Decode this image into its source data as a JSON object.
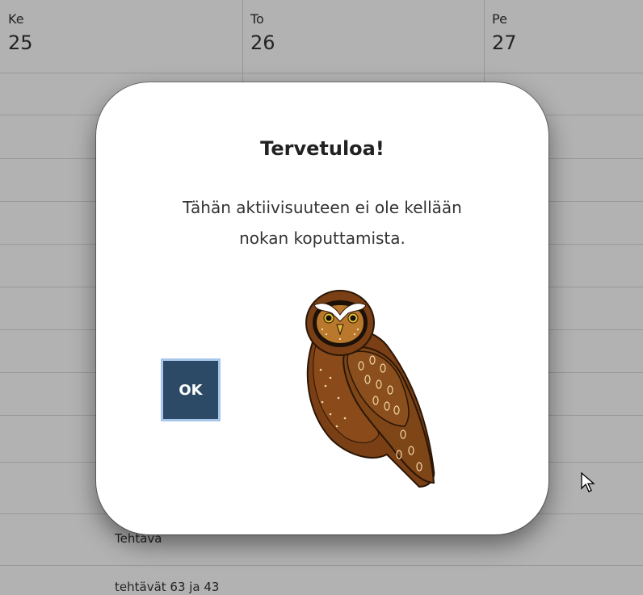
{
  "calendar": {
    "days": [
      {
        "name": "Ke",
        "number": "25"
      },
      {
        "name": "To",
        "number": "26"
      },
      {
        "name": "Pe",
        "number": "27"
      }
    ],
    "task_label": "Tehtävä",
    "task_text": "tehtävät 63 ja 43"
  },
  "dialog": {
    "title": "Tervetuloa!",
    "message_line1": "Tähän aktiivisuuteen ei ole kellään",
    "message_line2": "nokan koputtamista.",
    "ok_label": "OK"
  },
  "colors": {
    "ok_button_bg": "#2c4a66",
    "ok_button_border": "#a7c6ea",
    "overlay": "rgba(0,0,0,0.30)"
  },
  "icons": {
    "owl": "owl-illustration",
    "cursor": "mouse-pointer-icon"
  }
}
